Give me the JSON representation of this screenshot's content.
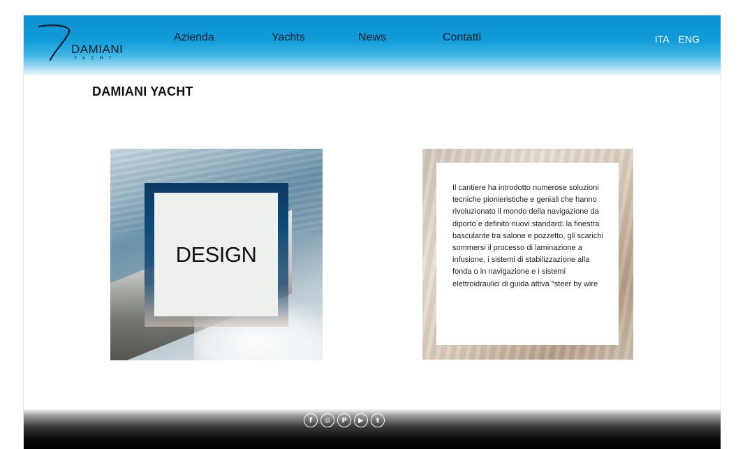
{
  "logo": {
    "brand": "DAMIANI",
    "sub": "YACHT"
  },
  "nav": [
    {
      "label": "Azienda"
    },
    {
      "label": "Yachts"
    },
    {
      "label": "News"
    },
    {
      "label": "Contatti"
    }
  ],
  "lang": {
    "ita": "ITA",
    "eng": "ENG"
  },
  "page_title": "DAMIANI YACHT",
  "design_tile": {
    "label": "DESIGN"
  },
  "text_tile": {
    "body": "Il cantiere ha introdotto numerose soluzioni tecniche pionieristiche e geniali che hanno rivoluzionato il mondo della navigazione da diporto e definito nuovi standard: la finestra basculante tra salone e pozzetto, gli scarichi sommersi il processo di laminazione a infusione, i sistemi di stabilizzazione alla fonda o in navigazione e i sistemi elettroidraulici di guida attiva \"steer by wire"
  },
  "social": [
    {
      "icon": "facebook-icon",
      "glyph": "f"
    },
    {
      "icon": "instagram-icon",
      "glyph": "◎"
    },
    {
      "icon": "pinterest-icon",
      "glyph": "P"
    },
    {
      "icon": "youtube-icon",
      "glyph": "▶"
    },
    {
      "icon": "twitter-icon",
      "glyph": "t"
    }
  ]
}
